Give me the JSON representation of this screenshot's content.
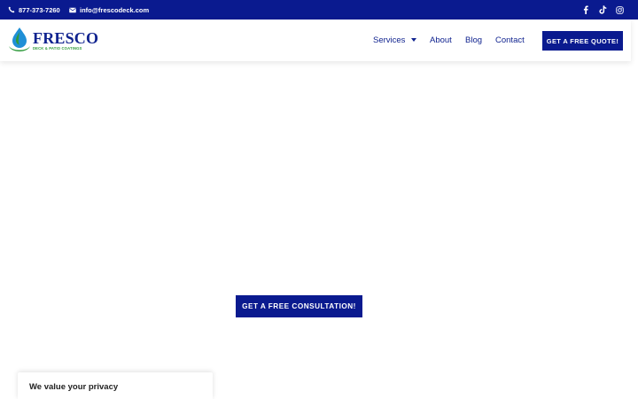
{
  "topbar": {
    "phone": "877-373-7260",
    "email": "info@frescodeck.com",
    "social_icons": [
      "facebook-icon",
      "tiktok-icon",
      "instagram-icon"
    ]
  },
  "header": {
    "logo": {
      "name": "FRESCO",
      "tagline": "DECK & PATIO COATINGS"
    },
    "nav": {
      "services": "Services",
      "about": "About",
      "blog": "Blog",
      "contact": "Contact"
    },
    "cta": "GET A FREE QUOTE!"
  },
  "main": {
    "cta": "GET A FREE CONSULTATION!"
  },
  "privacy_banner": {
    "title": "We value your privacy"
  },
  "colors": {
    "brand_navy": "#0a1a8f",
    "brand_green": "#2f9a3b",
    "brand_blue": "#1f8fd6",
    "text_navy": "#10238f"
  }
}
